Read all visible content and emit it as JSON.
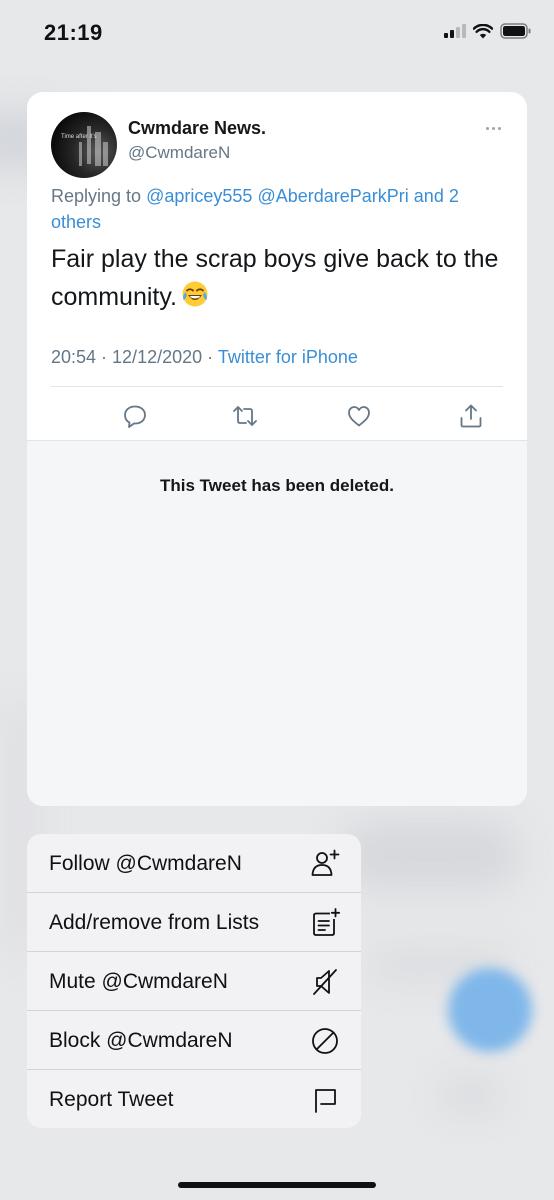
{
  "status_bar": {
    "time": "21:19",
    "icons": [
      "cellular-signal-icon",
      "wifi-icon",
      "battery-icon"
    ]
  },
  "tweet": {
    "author_name": "Cwmdare News.",
    "author_handle": "@CwmdareN",
    "avatar_text": "Time after it's",
    "reply_prefix": "Replying to",
    "mentions": [
      "@apricey555",
      "@AberdareParkPri",
      "and 2 others"
    ],
    "text": "Fair play the scrap boys give back to the community.",
    "emoji": "face-with-tears-of-joy",
    "timestamp": "20:54 · 12/12/2020 ·",
    "source": "Twitter for iPhone",
    "actions": [
      "reply-icon",
      "retweet-icon",
      "like-icon",
      "share-icon"
    ]
  },
  "deleted_notice": "This Tweet has been deleted.",
  "menu": {
    "items": [
      {
        "label": "Follow @CwmdareN",
        "icon": "follow-person-icon"
      },
      {
        "label": "Add/remove from Lists",
        "icon": "list-add-icon"
      },
      {
        "label": "Mute @CwmdareN",
        "icon": "mute-speaker-icon"
      },
      {
        "label": "Block @CwmdareN",
        "icon": "block-icon"
      },
      {
        "label": "Report Tweet",
        "icon": "report-flag-icon"
      }
    ]
  },
  "colors": {
    "link": "#3a8ed6",
    "secondary_text": "#657786",
    "fab_blue": "#7fb7ea"
  }
}
